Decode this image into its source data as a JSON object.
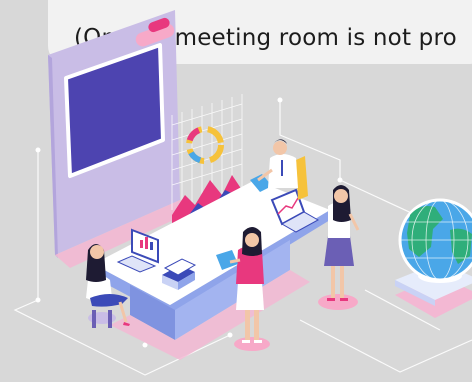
{
  "banner": {
    "top_line_partial": "",
    "text": "(On-site meeting room is not pro"
  },
  "colors": {
    "background": "#d8d8d8",
    "screen_panel": "#c9bde6",
    "screen": "#4d44b0",
    "table_top": "#ffffff",
    "table_side": "#8fa4ea",
    "pink_accent": "#e8387e",
    "floor_pink": "#f3b8d3",
    "globe_water": "#4aa7e8",
    "globe_land": "#2fae7a"
  },
  "icons": [
    "presentation-screen-icon",
    "hologram-chart-icon",
    "globe-icon",
    "laptop-icon",
    "monitor-icon"
  ]
}
